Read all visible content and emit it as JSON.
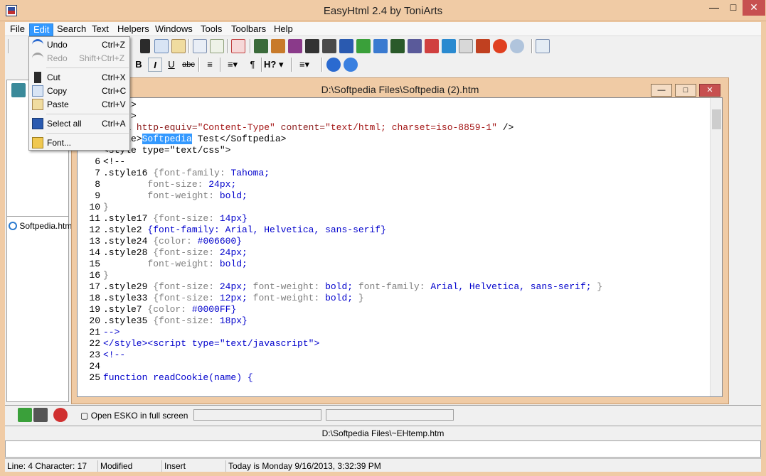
{
  "window": {
    "title": "EasyHtml 2.4 by ToniArts"
  },
  "menubar": [
    "File",
    "Edit",
    "Search",
    "Text",
    "Helpers",
    "Windows",
    "Tools",
    "Toolbars",
    "Help"
  ],
  "edit_menu": {
    "undo": {
      "label": "Undo",
      "shortcut": "Ctrl+Z"
    },
    "redo": {
      "label": "Redo",
      "shortcut": "Shift+Ctrl+Z"
    },
    "cut": {
      "label": "Cut",
      "shortcut": "Ctrl+X"
    },
    "copy": {
      "label": "Copy",
      "shortcut": "Ctrl+C"
    },
    "paste": {
      "label": "Paste",
      "shortcut": "Ctrl+V"
    },
    "select_all": {
      "label": "Select all",
      "shortcut": "Ctrl+A"
    },
    "font": {
      "label": "Font..."
    }
  },
  "format_toolbar": {
    "bold": "B",
    "italic": "I",
    "underline": "U",
    "strike": "abc",
    "pilcrow": "¶",
    "heading": "H?"
  },
  "left_panel": {
    "file": "Softpedia.htm"
  },
  "document": {
    "title": "D:\\Softpedia Files\\Softpedia (2).htm",
    "lines": [
      {
        "n": "",
        "parts": [
          [
            "k",
            "<html>"
          ]
        ]
      },
      {
        "n": "",
        "parts": [
          [
            "k",
            "<head>"
          ]
        ]
      },
      {
        "n": "",
        "parts": [
          [
            "k",
            "<meta "
          ],
          [
            "attr",
            "http-equiv="
          ],
          [
            "str",
            "\"Content-Type\""
          ],
          [
            "attr",
            " content="
          ],
          [
            "str",
            "\"text/html; charset=iso-8859-1\""
          ],
          [
            "k",
            " />"
          ]
        ]
      },
      {
        "n": "",
        "parts": [
          [
            "k",
            "<title>"
          ],
          [
            "sel",
            "Softpedia"
          ],
          [
            "k",
            " Test</Softpedia>"
          ]
        ]
      },
      {
        "n": "",
        "parts": [
          [
            "k",
            "<style type=\"text/css\">"
          ]
        ]
      },
      {
        "n": "6",
        "parts": [
          [
            "k",
            "<!--"
          ]
        ]
      },
      {
        "n": "7",
        "parts": [
          [
            "k",
            ".style16 "
          ],
          [
            "grey",
            "{font-family: "
          ],
          [
            "blue",
            "Tahoma;"
          ]
        ]
      },
      {
        "n": "8",
        "parts": [
          [
            "grey",
            "        font-size: "
          ],
          [
            "blue",
            "24px;"
          ]
        ]
      },
      {
        "n": "9",
        "parts": [
          [
            "grey",
            "        font-weight: "
          ],
          [
            "blue",
            "bold;"
          ]
        ]
      },
      {
        "n": "10",
        "parts": [
          [
            "grey",
            "}"
          ]
        ]
      },
      {
        "n": "11",
        "parts": [
          [
            "k",
            ".style17 "
          ],
          [
            "grey",
            "{font-size: "
          ],
          [
            "blue",
            "14px}"
          ]
        ]
      },
      {
        "n": "12",
        "parts": [
          [
            "k",
            ".style2 "
          ],
          [
            "blue",
            "{font-family: Arial, Helvetica, sans-serif}"
          ]
        ]
      },
      {
        "n": "13",
        "parts": [
          [
            "k",
            ".style24 "
          ],
          [
            "grey",
            "{color: "
          ],
          [
            "blue",
            "#006600}"
          ]
        ]
      },
      {
        "n": "14",
        "parts": [
          [
            "k",
            ".style28 "
          ],
          [
            "grey",
            "{font-size: "
          ],
          [
            "blue",
            "24px;"
          ]
        ]
      },
      {
        "n": "15",
        "parts": [
          [
            "grey",
            "        font-weight: "
          ],
          [
            "blue",
            "bold;"
          ]
        ]
      },
      {
        "n": "16",
        "parts": [
          [
            "grey",
            "}"
          ]
        ]
      },
      {
        "n": "17",
        "parts": [
          [
            "k",
            ".style29 "
          ],
          [
            "grey",
            "{font-size: "
          ],
          [
            "blue",
            "24px; "
          ],
          [
            "grey",
            "font-weight: "
          ],
          [
            "blue",
            "bold; "
          ],
          [
            "grey",
            "font-family: "
          ],
          [
            "blue",
            "Arial, Helvetica, sans-serif; "
          ],
          [
            "grey",
            "}"
          ]
        ]
      },
      {
        "n": "18",
        "parts": [
          [
            "k",
            ".style33 "
          ],
          [
            "grey",
            "{font-size: "
          ],
          [
            "blue",
            "12px; "
          ],
          [
            "grey",
            "font-weight: "
          ],
          [
            "blue",
            "bold; "
          ],
          [
            "grey",
            "}"
          ]
        ]
      },
      {
        "n": "19",
        "parts": [
          [
            "k",
            ".style7 "
          ],
          [
            "grey",
            "{color: "
          ],
          [
            "blue",
            "#0000FF}"
          ]
        ]
      },
      {
        "n": "20",
        "parts": [
          [
            "k",
            ".style35 "
          ],
          [
            "grey",
            "{font-size: "
          ],
          [
            "blue",
            "18px}"
          ]
        ]
      },
      {
        "n": "21",
        "parts": [
          [
            "blue",
            "-->"
          ]
        ]
      },
      {
        "n": "22",
        "parts": [
          [
            "blue",
            "</style><script type=\"text/javascript\">"
          ]
        ]
      },
      {
        "n": "23",
        "parts": [
          [
            "blue",
            "<!--"
          ]
        ]
      },
      {
        "n": "24",
        "parts": []
      },
      {
        "n": "25",
        "parts": [
          [
            "blue",
            "function readCookie(name) {"
          ]
        ]
      }
    ]
  },
  "bottom": {
    "open_esko": "Open ESKO in full screen",
    "temp_path": "D:\\Softpedia Files\\~EHtemp.htm"
  },
  "status": {
    "position": "Line: 4 Character: 17",
    "modified": "Modified",
    "mode": "Insert",
    "date": "Today is Monday 9/16/2013, 3:32:39 PM"
  },
  "colors": {
    "frame": "#f0cba5",
    "menu_highlight": "#3399ff",
    "selection": "#3399ff"
  }
}
